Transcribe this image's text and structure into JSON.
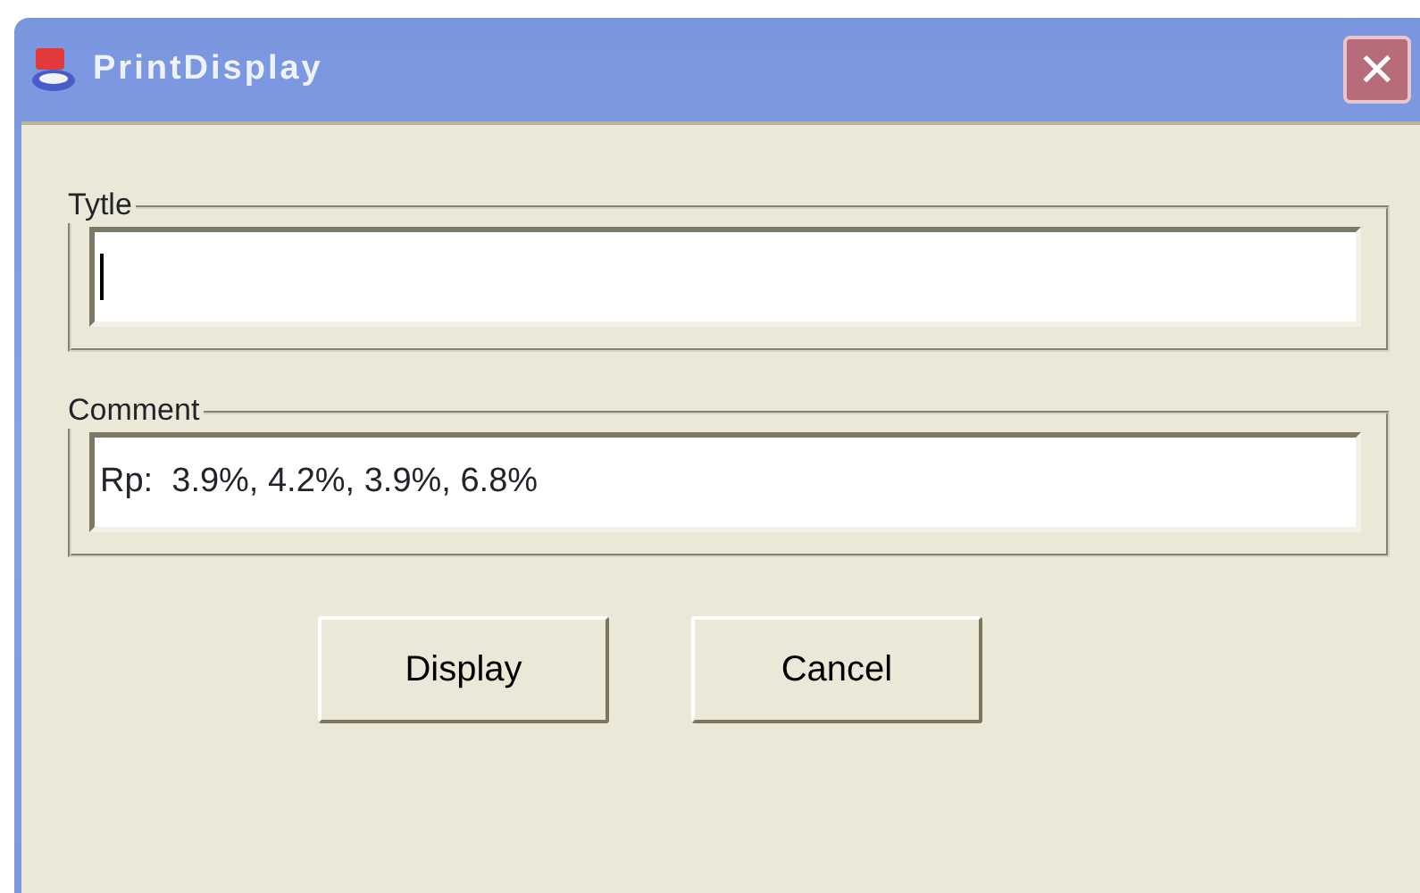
{
  "window": {
    "title": "PrintDisplay",
    "close": "✕"
  },
  "groups": [
    {
      "label": "Tytle",
      "focused": true
    },
    {
      "label": "Comment",
      "value": "Rp:  3.9%, 4.2%, 3.9%, 6.8%",
      "focused": false
    }
  ],
  "buttons": [
    "Display",
    "Cancel"
  ]
}
